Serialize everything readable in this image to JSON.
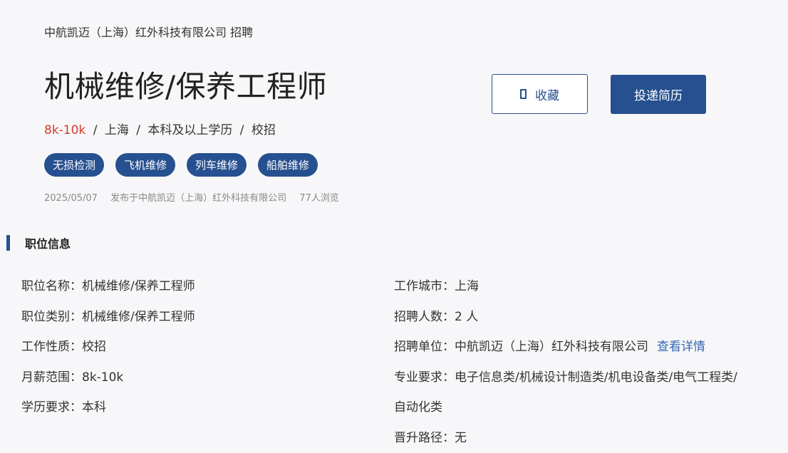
{
  "header": {
    "company_line": "中航凯迈（上海）红外科技有限公司 招聘",
    "job_title": "机械维修/保养工程师",
    "summary": {
      "salary": "8k-10k",
      "separator": "/",
      "city": "上海",
      "education": "本科及以上学历",
      "type": "校招"
    },
    "tags": [
      "无损检测",
      "飞机维修",
      "列车维修",
      "船舶维修"
    ],
    "meta": {
      "date": "2025/05/07",
      "publisher": "发布于中航凯迈（上海）红外科技有限公司",
      "views": "77人浏览"
    }
  },
  "actions": {
    "favorite_label": "收藏",
    "apply_label": "投递简历"
  },
  "section": {
    "title": "职位信息"
  },
  "info_left": [
    {
      "label": "职位名称：",
      "value": "机械维修/保养工程师"
    },
    {
      "label": "职位类别：",
      "value": "机械维修/保养工程师"
    },
    {
      "label": "工作性质：",
      "value": "校招"
    },
    {
      "label": "月薪范围：",
      "value": "8k-10k"
    },
    {
      "label": "学历要求：",
      "value": "本科"
    }
  ],
  "info_right": {
    "city": {
      "label": "工作城市：",
      "value": "上海"
    },
    "headcount": {
      "label": "招聘人数：",
      "value": "2 人"
    },
    "employer": {
      "label": "招聘单位：",
      "value": "中航凯迈（上海）红外科技有限公司",
      "link": "查看详情"
    },
    "major": {
      "label": "专业要求：",
      "value_line1": "电子信息类/机械设计制造类/机电设备类/电气工程类/",
      "value_line2": "自动化类"
    },
    "career": {
      "label": "晋升路径：",
      "value": "无"
    }
  },
  "colors": {
    "accent": "#26508f",
    "salary": "#d63b2a",
    "link": "#3569b5"
  }
}
